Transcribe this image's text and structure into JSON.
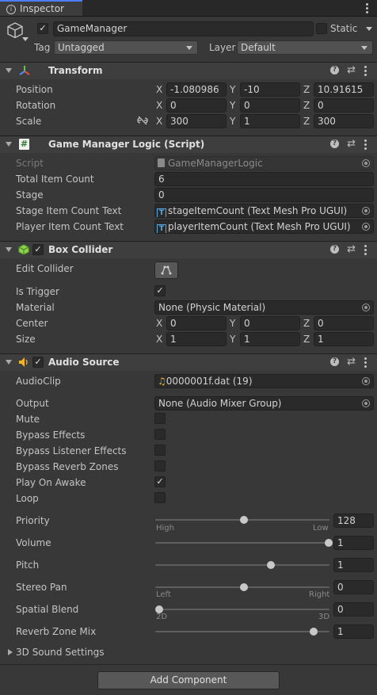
{
  "tab": {
    "label": "Inspector"
  },
  "object": {
    "name": "GameManager",
    "static_label": "Static",
    "tag_label": "Tag",
    "tag_value": "Untagged",
    "layer_label": "Layer",
    "layer_value": "Default"
  },
  "transform": {
    "title": "Transform",
    "position": {
      "label": "Position",
      "x": "-1.080986",
      "y": "-10",
      "z": "10.91615"
    },
    "rotation": {
      "label": "Rotation",
      "x": "0",
      "y": "0",
      "z": "0"
    },
    "scale": {
      "label": "Scale",
      "x": "300",
      "y": "1",
      "z": "300"
    }
  },
  "axes": {
    "x": "X",
    "y": "Y",
    "z": "Z"
  },
  "logic": {
    "title": "Game Manager Logic (Script)",
    "script": {
      "label": "Script",
      "value": "GameManagerLogic"
    },
    "total": {
      "label": "Total Item Count",
      "value": "6"
    },
    "stage": {
      "label": "Stage",
      "value": "0"
    },
    "stage_text": {
      "label": "Stage Item Count Text",
      "value": "stageItemCount (Text Mesh Pro UGUI)"
    },
    "player_text": {
      "label": "Player Item Count Text",
      "value": "playerItemCount (Text Mesh Pro UGUI)"
    },
    "tm_glyph": "T"
  },
  "box": {
    "title": "Box Collider",
    "edit_collider": "Edit Collider",
    "is_trigger": "Is Trigger",
    "material": {
      "label": "Material",
      "value": "None (Physic Material)"
    },
    "center": {
      "label": "Center",
      "x": "0",
      "y": "0",
      "z": "0"
    },
    "size": {
      "label": "Size",
      "x": "1",
      "y": "1",
      "z": "1"
    }
  },
  "audio": {
    "title": "Audio Source",
    "clip": {
      "label": "AudioClip",
      "value": "0000001f.dat (19)"
    },
    "output": {
      "label": "Output",
      "value": "None (Audio Mixer Group)"
    },
    "mute": "Mute",
    "bypass_effects": "Bypass Effects",
    "bypass_listener": "Bypass Listener Effects",
    "bypass_reverb": "Bypass Reverb Zones",
    "play_on_awake": "Play On Awake",
    "loop": "Loop",
    "priority": {
      "label": "Priority",
      "value": "128",
      "fraction": 0.5,
      "low_caption": "High",
      "high_caption": "Low"
    },
    "volume": {
      "label": "Volume",
      "value": "1",
      "fraction": 1.0
    },
    "pitch": {
      "label": "Pitch",
      "value": "1",
      "fraction": 0.66
    },
    "stereo_pan": {
      "label": "Stereo Pan",
      "value": "0",
      "fraction": 0.5,
      "low_caption": "Left",
      "high_caption": "Right"
    },
    "spatial_blend": {
      "label": "Spatial Blend",
      "value": "0",
      "fraction": 0.0,
      "low_caption": "2D",
      "high_caption": "3D"
    },
    "reverb_mix": {
      "label": "Reverb Zone Mix",
      "value": "1",
      "fraction": 0.91
    },
    "sound_settings": "3D Sound Settings"
  },
  "add_component": "Add Component",
  "checkmark": "✓",
  "colors": {
    "accent": "#4c7eff",
    "panel": "#383838",
    "header": "#3e3e3e",
    "field": "#2a2a2a"
  }
}
